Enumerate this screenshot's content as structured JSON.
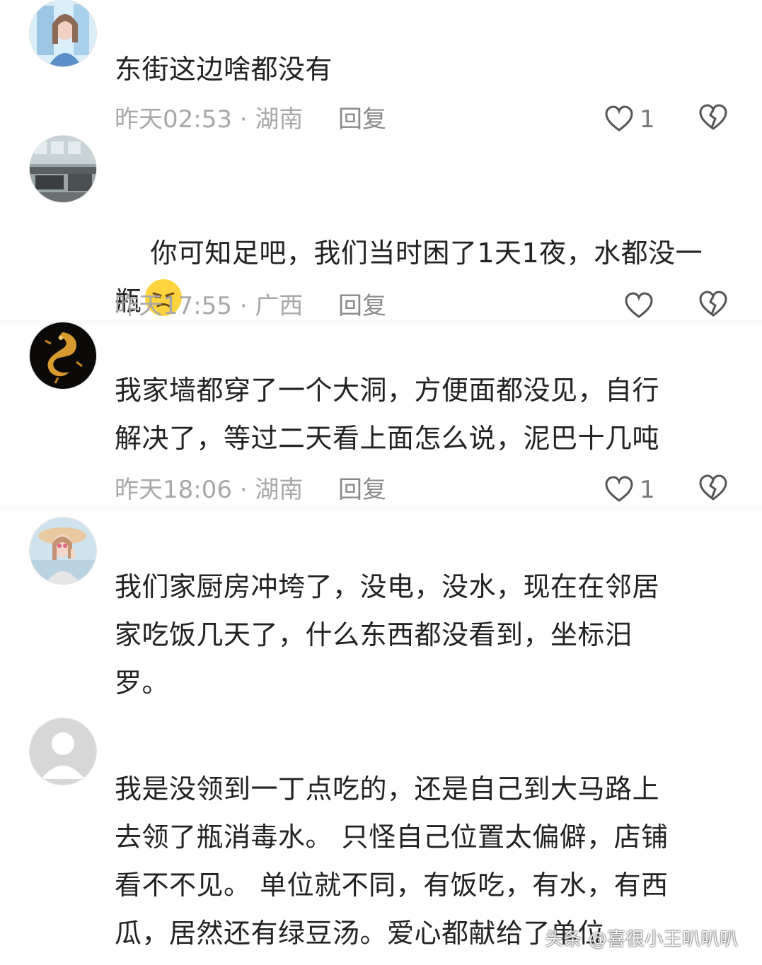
{
  "comments": [
    {
      "avatar": "profile-photo-girl-blue",
      "text": "东街这边啥都没有",
      "time_location": "昨天02:53 · 湖南",
      "reply": "回复",
      "likes": "1"
    },
    {
      "avatar": "profile-photo-office",
      "text": "你可知足吧，我们当时困了1天1夜，水都没一\n瓶",
      "emoji": "frowning-face-emoji",
      "time_location": "昨天17:55 · 广西",
      "reply": "回复",
      "likes": ""
    },
    {
      "avatar": "profile-photo-golden-dragon",
      "text": "我家墙都穿了一个大洞，方便面都没见，自行\n解决了，等过二天看上面怎么说，泥巴十几吨",
      "time_location": "昨天18:06 · 湖南",
      "reply": "回复",
      "likes": "1"
    },
    {
      "avatar": "profile-photo-woman-hat",
      "text": "我们家厨房冲垮了，没电，没水，现在在邻居\n家吃饭几天了，什么东西都没看到，坐标汨\n罗。"
    },
    {
      "avatar": "default-avatar",
      "text": "我是没领到一丁点吃的，还是自己到大马路上\n去领了瓶消毒水。 只怪自己位置太偏僻，店铺\n看不不见。 单位就不同，有饭吃，有水，有西\n瓜，居然还有绿豆汤。爱心都献给了单位"
    }
  ],
  "watermark": "头条 @喜很小王叭叭叭",
  "colors": {
    "text": "#222222",
    "meta": "#a8a8a8",
    "icon": "#555555"
  }
}
